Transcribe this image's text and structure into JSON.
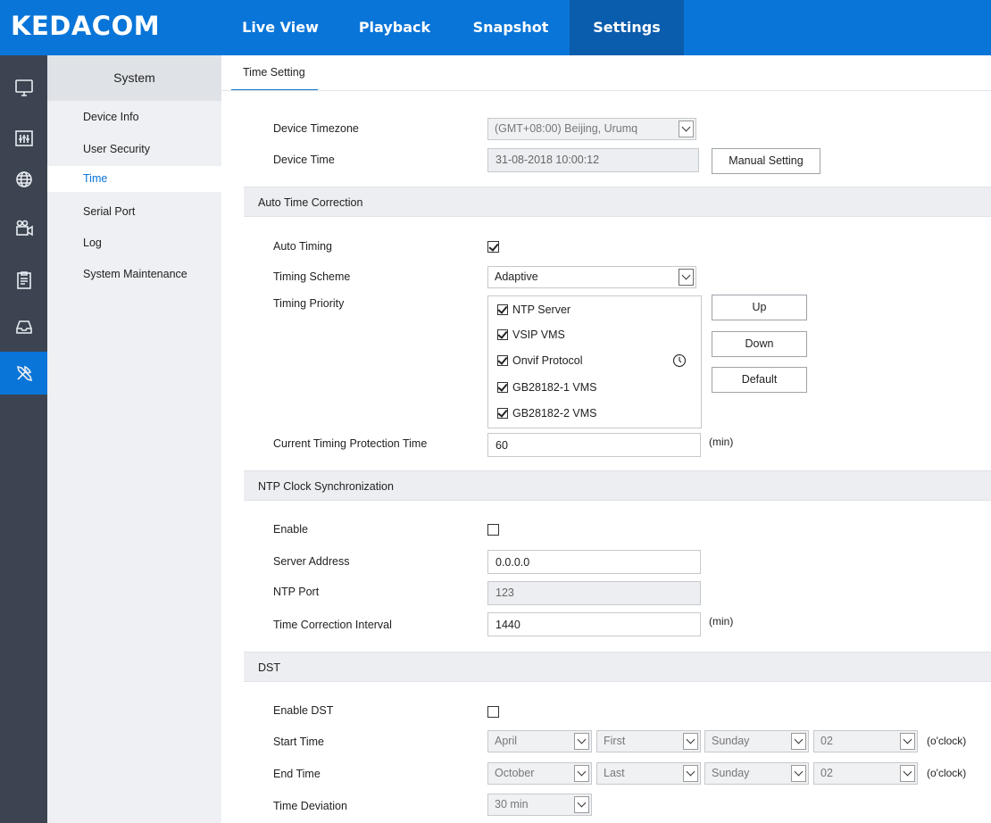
{
  "app": {
    "logo": "KEDACOM",
    "nav": [
      "Live View",
      "Playback",
      "Snapshot",
      "Settings"
    ],
    "active_nav": "Settings"
  },
  "rail_icons": [
    "monitor-icon",
    "equalizer-icon",
    "globe-icon",
    "camera-icon",
    "clipboard-icon",
    "storage-icon",
    "tools-icon"
  ],
  "sidebar": {
    "title": "System",
    "items": [
      "Device Info",
      "User Security",
      "Time",
      "Serial Port",
      "Log",
      "System Maintenance"
    ],
    "active": "Time"
  },
  "subtab": "Time Setting",
  "device": {
    "timezone_label": "Device Timezone",
    "timezone_value": "(GMT+08:00) Beijing, Urumq",
    "time_label": "Device Time",
    "time_value": "31-08-2018 10:00:12",
    "manual_button": "Manual Setting"
  },
  "auto_correction": {
    "section_title": "Auto Time Correction",
    "auto_timing_label": "Auto Timing",
    "auto_timing_checked": true,
    "scheme_label": "Timing Scheme",
    "scheme_value": "Adaptive",
    "priority_label": "Timing Priority",
    "priority_items": [
      {
        "label": "NTP Server",
        "checked": true
      },
      {
        "label": "VSIP VMS",
        "checked": true
      },
      {
        "label": "Onvif Protocol",
        "checked": true
      },
      {
        "label": "GB28182-1 VMS",
        "checked": true
      },
      {
        "label": "GB28182-2 VMS",
        "checked": true
      }
    ],
    "up_button": "Up",
    "down_button": "Down",
    "default_button": "Default",
    "protection_label": "Current Timing Protection Time",
    "protection_value": "60",
    "protection_unit": "(min)"
  },
  "ntp": {
    "section_title": "NTP Clock Synchronization",
    "enable_label": "Enable",
    "enable_checked": false,
    "server_label": "Server Address",
    "server_value": "0.0.0.0",
    "port_label": "NTP Port",
    "port_value": "123",
    "interval_label": "Time Correction Interval",
    "interval_value": "1440",
    "interval_unit": "(min)"
  },
  "dst": {
    "section_title": "DST",
    "enable_label": "Enable DST",
    "enable_checked": false,
    "start_label": "Start Time",
    "start": {
      "month": "April",
      "week": "First",
      "day": "Sunday",
      "hour": "02"
    },
    "end_label": "End Time",
    "end": {
      "month": "October",
      "week": "Last",
      "day": "Sunday",
      "hour": "02"
    },
    "oclock": "(o'clock)",
    "deviation_label": "Time Deviation",
    "deviation_value": "30 min"
  }
}
